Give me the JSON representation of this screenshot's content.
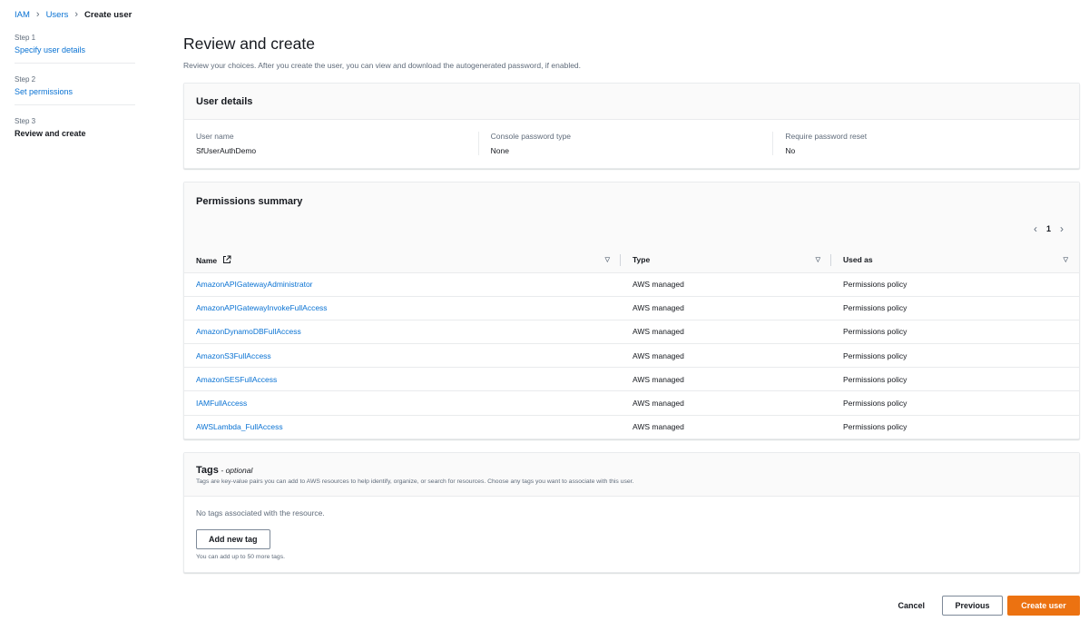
{
  "breadcrumb": [
    {
      "label": "IAM"
    },
    {
      "label": "Users"
    },
    {
      "label": "Create user"
    }
  ],
  "steps": [
    {
      "num": "Step 1",
      "label": "Specify user details",
      "active": false
    },
    {
      "num": "Step 2",
      "label": "Set permissions",
      "active": false
    },
    {
      "num": "Step 3",
      "label": "Review and create",
      "active": true
    }
  ],
  "page": {
    "title": "Review and create",
    "description": "Review your choices. After you create the user, you can view and download the autogenerated password, if enabled."
  },
  "user_details": {
    "title": "User details",
    "fields": [
      {
        "label": "User name",
        "value": "SfUserAuthDemo"
      },
      {
        "label": "Console password type",
        "value": "None"
      },
      {
        "label": "Require password reset",
        "value": "No"
      }
    ]
  },
  "permissions": {
    "title": "Permissions summary",
    "current_page": "1",
    "columns": [
      "Name",
      "Type",
      "Used as"
    ],
    "rows": [
      {
        "name": "AmazonAPIGatewayAdministrator",
        "type": "AWS managed",
        "used_as": "Permissions policy"
      },
      {
        "name": "AmazonAPIGatewayInvokeFullAccess",
        "type": "AWS managed",
        "used_as": "Permissions policy"
      },
      {
        "name": "AmazonDynamoDBFullAccess",
        "type": "AWS managed",
        "used_as": "Permissions policy"
      },
      {
        "name": "AmazonS3FullAccess",
        "type": "AWS managed",
        "used_as": "Permissions policy"
      },
      {
        "name": "AmazonSESFullAccess",
        "type": "AWS managed",
        "used_as": "Permissions policy"
      },
      {
        "name": "IAMFullAccess",
        "type": "AWS managed",
        "used_as": "Permissions policy"
      },
      {
        "name": "AWSLambda_FullAccess",
        "type": "AWS managed",
        "used_as": "Permissions policy"
      }
    ]
  },
  "tags": {
    "title": "Tags",
    "optional": "- optional",
    "description": "Tags are key-value pairs you can add to AWS resources to help identify, organize, or search for resources. Choose any tags you want to associate with this user.",
    "empty_text": "No tags associated with the resource.",
    "add_button": "Add new tag",
    "limit_text": "You can add up to 50 more tags."
  },
  "footer": {
    "cancel": "Cancel",
    "previous": "Previous",
    "create": "Create user"
  },
  "colors": {
    "link": "#0972d3",
    "primary_button": "#ec7211",
    "border": "#e9ebed"
  },
  "icons": [
    "chevron-right-icon",
    "external-link-icon",
    "sort-caret-icon",
    "chevron-left-icon"
  ]
}
